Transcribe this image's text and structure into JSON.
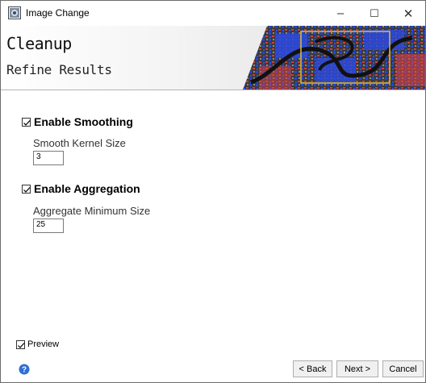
{
  "window": {
    "title": "Image Change",
    "controls": {
      "minimize": "–",
      "maximize": "☐",
      "close": "✕"
    }
  },
  "banner": {
    "title": "Cleanup",
    "subtitle": "Refine Results"
  },
  "options": {
    "smoothing": {
      "label": "Enable Smoothing",
      "checked": true,
      "field_label": "Smooth Kernel Size",
      "field_value": "3"
    },
    "aggregation": {
      "label": "Enable Aggregation",
      "checked": true,
      "field_label": "Aggregate Minimum Size",
      "field_value": "25"
    }
  },
  "preview": {
    "label": "Preview",
    "checked": true
  },
  "buttons": {
    "back": "< Back",
    "next": "Next >",
    "cancel": "Cancel"
  },
  "colors": {
    "help_icon": "#2f6fd1",
    "banner_gradient_end": "#dcdcdc"
  }
}
